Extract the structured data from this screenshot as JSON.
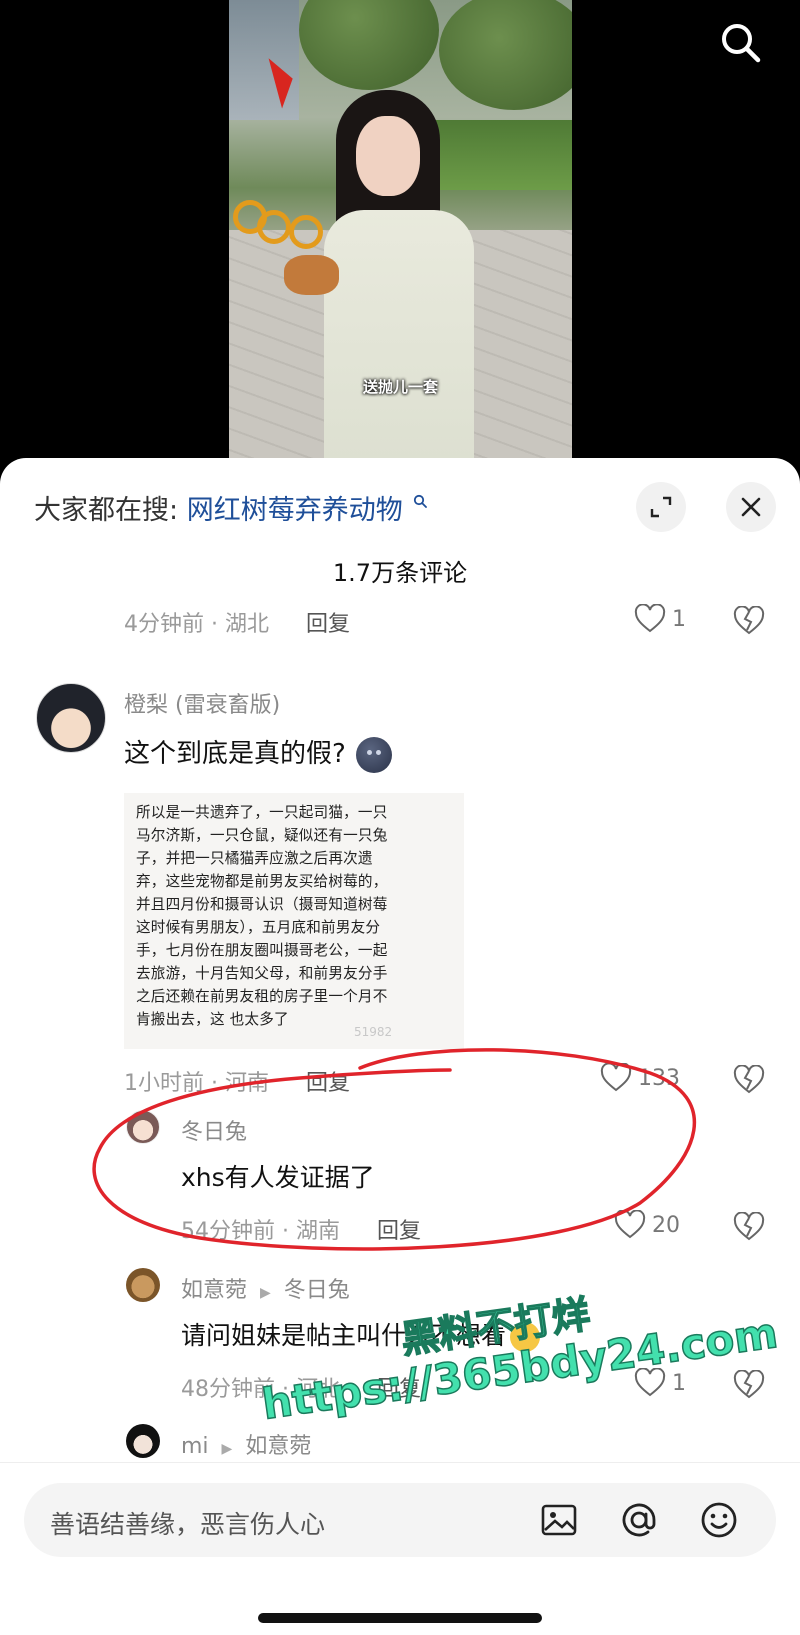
{
  "video": {
    "subtitle": "送抛儿一套"
  },
  "header": {
    "trending_prefix": "大家都在搜:",
    "trending_term": "网红树莓弃养动物",
    "comment_count": "1.7万条评论"
  },
  "previous_comment": {
    "time_location": "4分钟前 · 湖北",
    "reply_label": "回复",
    "likes": "1"
  },
  "main_comment": {
    "author": "橙梨 (雷衰畜版)",
    "text": "这个到底是真的假?",
    "image_text_lines": [
      "所以是一共遗弃了，一只起司猫，一只",
      "马尔济斯，一只仓鼠，疑似还有一只兔",
      "子，并把一只橘猫弄应激之后再次遗",
      "弃，这些宠物都是前男友买给树莓的，",
      "并且四月份和摄哥认识（摄哥知道树莓",
      "这时候有男朋友），五月底和前男友分",
      "手，七月份在朋友圈叫摄哥老公，一起",
      "去旅游，十月告知父母，和前男友分手",
      "之后还赖在前男友租的房子里一个月不",
      "肯搬出去，这 也太多了"
    ],
    "image_watermark": "51982",
    "time_location": "1小时前 · 河南",
    "reply_label": "回复",
    "likes": "133"
  },
  "replies": [
    {
      "author": "冬日兔",
      "reply_to": "",
      "text": "xhs有人发证据了",
      "time_location": "54分钟前 · 湖南",
      "reply_label": "回复",
      "likes": "20"
    },
    {
      "author": "如意菀",
      "reply_to": "冬日兔",
      "text": "请问姐妹是帖主叫什么不想看",
      "time_location": "48分钟前 · 河北",
      "reply_label": "回复",
      "likes": "1"
    },
    {
      "author": "mi",
      "reply_to": "如意菀",
      "text": "",
      "time_location": "",
      "reply_label": "",
      "likes": ""
    }
  ],
  "watermark": {
    "line1": "黑料不打烊",
    "line2": "https://365bdy24.com"
  },
  "input": {
    "placeholder": "善语结善缘，恶言伤人心"
  },
  "icons": {
    "search": "search-icon",
    "expand": "expand-icon",
    "close": "close-icon",
    "heart": "heart-icon",
    "broken_heart": "broken-heart-icon",
    "image": "image-icon",
    "mention": "at-icon",
    "emoji": "emoji-icon"
  },
  "colors": {
    "trending_term": "#1f4f99",
    "annotation_red": "#e0242b",
    "watermark_green": "#43e0ad"
  }
}
